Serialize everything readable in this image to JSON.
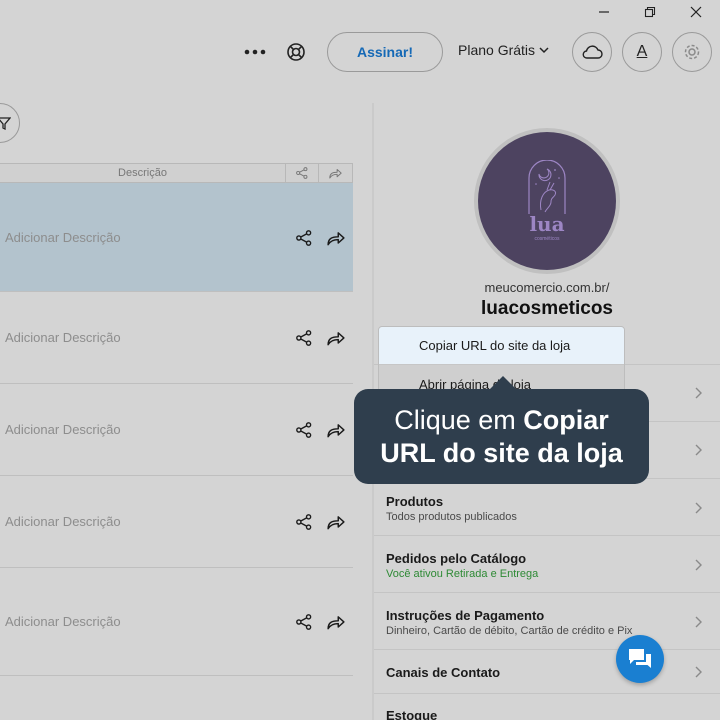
{
  "header": {
    "assinar_label": "Assinar!",
    "plano_label": "Plano Grátis",
    "account_initial": "A"
  },
  "table": {
    "col_descricao": "Descrição",
    "rows": [
      {
        "descricao": "Adicionar Descrição",
        "selected": true
      },
      {
        "descricao": "Adicionar Descrição",
        "selected": false
      },
      {
        "descricao": "Adicionar Descrição",
        "selected": false
      },
      {
        "descricao": "Adicionar Descrição",
        "selected": false
      },
      {
        "descricao": "Adicionar Descrição",
        "selected": false
      }
    ]
  },
  "store": {
    "logo_text": "lua",
    "logo_sub": "cosméticos",
    "domain": "meucomercio.com.br/",
    "name": "luacosmeticos"
  },
  "dropdown": {
    "item1": "Copiar URL do site da loja",
    "item2": "Abrir página da loja"
  },
  "tooltip": {
    "line1_plain": "Clique em ",
    "line1_bold": "Copiar",
    "line2_bold": "URL do site da loja"
  },
  "menu": [
    {
      "title": "Produtos",
      "subtitle": "Todos produtos publicados",
      "subtitle_color": "#4a4a4a"
    },
    {
      "title": "Pedidos pelo Catálogo",
      "subtitle": "Você ativou Retirada e Entrega",
      "subtitle_color": "#2e8a35"
    },
    {
      "title": "Instruções de Pagamento",
      "subtitle": "Dinheiro, Cartão de débito, Cartão de crédito e Pix",
      "subtitle_color": "#4a4a4a"
    },
    {
      "title": "Canais de Contato",
      "subtitle": ""
    },
    {
      "title": "Estoque",
      "subtitle": ""
    }
  ],
  "colors": {
    "accent": "#1569b6",
    "tooltip_bg": "#2f3e4d",
    "fab": "#1a7fd1",
    "selected_row": "#b3c3cd",
    "avatar_bg": "#4d4360"
  },
  "icons": [
    "minimize-icon",
    "restore-icon",
    "close-icon",
    "more-icon",
    "help-icon",
    "chevron-down-icon",
    "cloud-icon",
    "gear-icon",
    "filter-icon",
    "share-icon",
    "forward-icon",
    "chevron-right-icon",
    "chat-icon"
  ]
}
